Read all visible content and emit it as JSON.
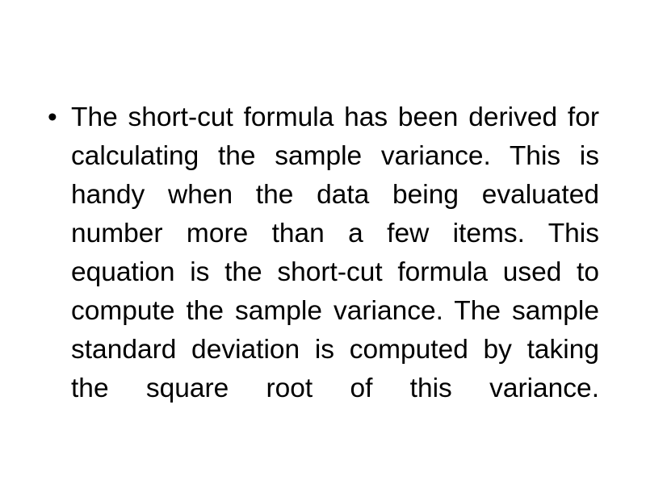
{
  "slide": {
    "background_color": "#ffffff",
    "text_color": "#000000",
    "body": {
      "bullets": [
        {
          "marker": "•",
          "text": "The short-cut formula has been derived for calculating the sample variance. This is handy when the data being evaluated number more than a few items. This equation is the short-cut formula used to compute the sample variance. The sample standard deviation is computed by taking the square root of this variance."
        }
      ]
    }
  }
}
